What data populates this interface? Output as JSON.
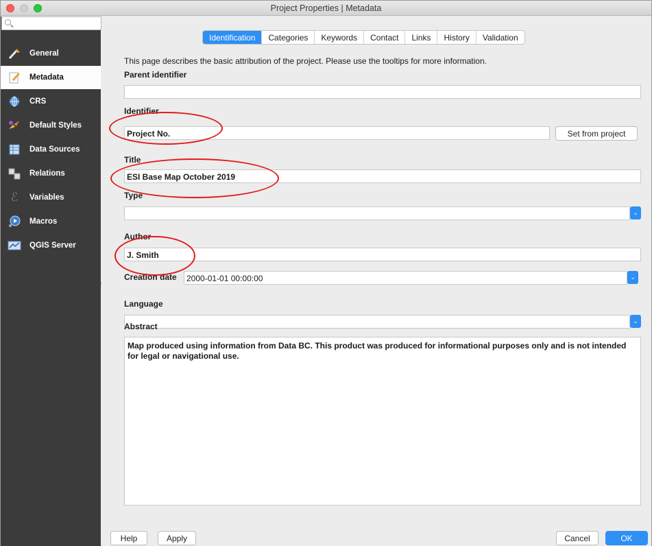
{
  "window": {
    "title": "Project Properties | Metadata"
  },
  "sidebar": {
    "items": [
      {
        "label": "General",
        "icon": "wrench-icon"
      },
      {
        "label": "Metadata",
        "icon": "pencil-icon"
      },
      {
        "label": "CRS",
        "icon": "globe-icon"
      },
      {
        "label": "Default Styles",
        "icon": "styles-icon"
      },
      {
        "label": "Data Sources",
        "icon": "table-icon"
      },
      {
        "label": "Relations",
        "icon": "relations-icon"
      },
      {
        "label": "Variables",
        "icon": "variables-icon"
      },
      {
        "label": "Macros",
        "icon": "macros-icon"
      },
      {
        "label": "QGIS Server",
        "icon": "server-icon"
      }
    ],
    "active": "Metadata"
  },
  "tabs": [
    "Identification",
    "Categories",
    "Keywords",
    "Contact",
    "Links",
    "History",
    "Validation"
  ],
  "active_tab": "Identification",
  "form": {
    "description": "This page describes the basic attribution of the project. Please use the tooltips for more information.",
    "parent_identifier": {
      "label": "Parent identifier",
      "value": ""
    },
    "identifier": {
      "label": "Identifier",
      "value": "Project No.",
      "button": "Set from project"
    },
    "title": {
      "label": "Title",
      "value": "ESI Base Map October 2019"
    },
    "type": {
      "label": "Type",
      "value": ""
    },
    "author": {
      "label": "Author",
      "value": "J. Smith"
    },
    "creation_date": {
      "label": "Creation date",
      "value": "2000-01-01 00:00:00"
    },
    "language": {
      "label": "Language",
      "value": ""
    },
    "abstract": {
      "label": "Abstract",
      "value": "Map produced using information from Data BC. This product was produced for informational purposes only and is not intended for legal or navigational use."
    }
  },
  "footer": {
    "help": "Help",
    "apply": "Apply",
    "cancel": "Cancel",
    "ok": "OK"
  },
  "colors": {
    "accent": "#2e8ff5",
    "sidebar_bg": "#3b3b3b",
    "annotation": "#e11a1a"
  }
}
